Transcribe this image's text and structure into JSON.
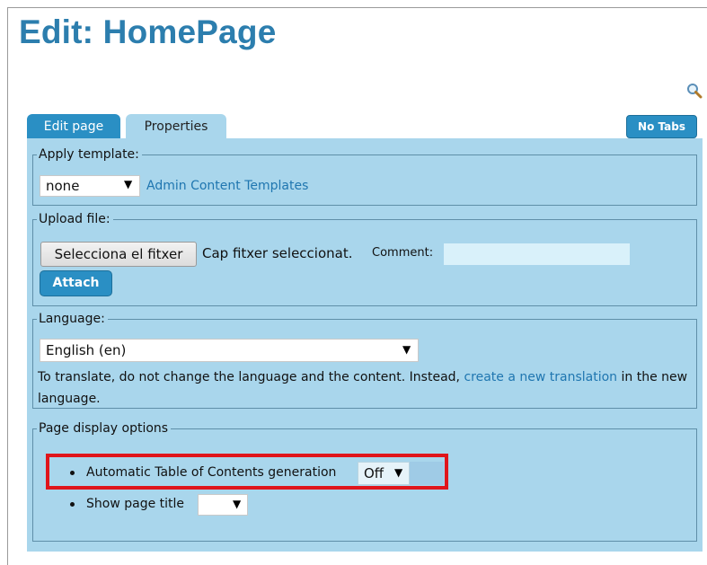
{
  "page": {
    "title": "Edit: HomePage"
  },
  "tabs": [
    {
      "label": "Edit page",
      "active": false
    },
    {
      "label": "Properties",
      "active": true
    }
  ],
  "toolbar": {
    "no_tabs_label": "No Tabs"
  },
  "apply_template": {
    "legend": "Apply template:",
    "selected": "none",
    "link_label": "Admin Content Templates"
  },
  "upload": {
    "legend": "Upload file:",
    "choose_button": "Selecciona el fitxer",
    "no_file_text": "Cap fitxer seleccionat.",
    "comment_label": "Comment:",
    "comment_value": "",
    "attach_button": "Attach"
  },
  "language": {
    "legend": "Language:",
    "selected": "English (en)",
    "help_before": "To translate, do not change the language and the content. Instead,",
    "help_link": "create a new translation",
    "help_after": "in the new language."
  },
  "display_options": {
    "legend": "Page display options",
    "items": [
      {
        "label": "Automatic Table of Contents generation",
        "value": "Off"
      },
      {
        "label": "Show page title",
        "value": ""
      }
    ]
  },
  "colors": {
    "accent": "#2a8fc4",
    "panel": "#a9d6ec",
    "title": "#2c7eae",
    "highlight": "#e0151b"
  }
}
